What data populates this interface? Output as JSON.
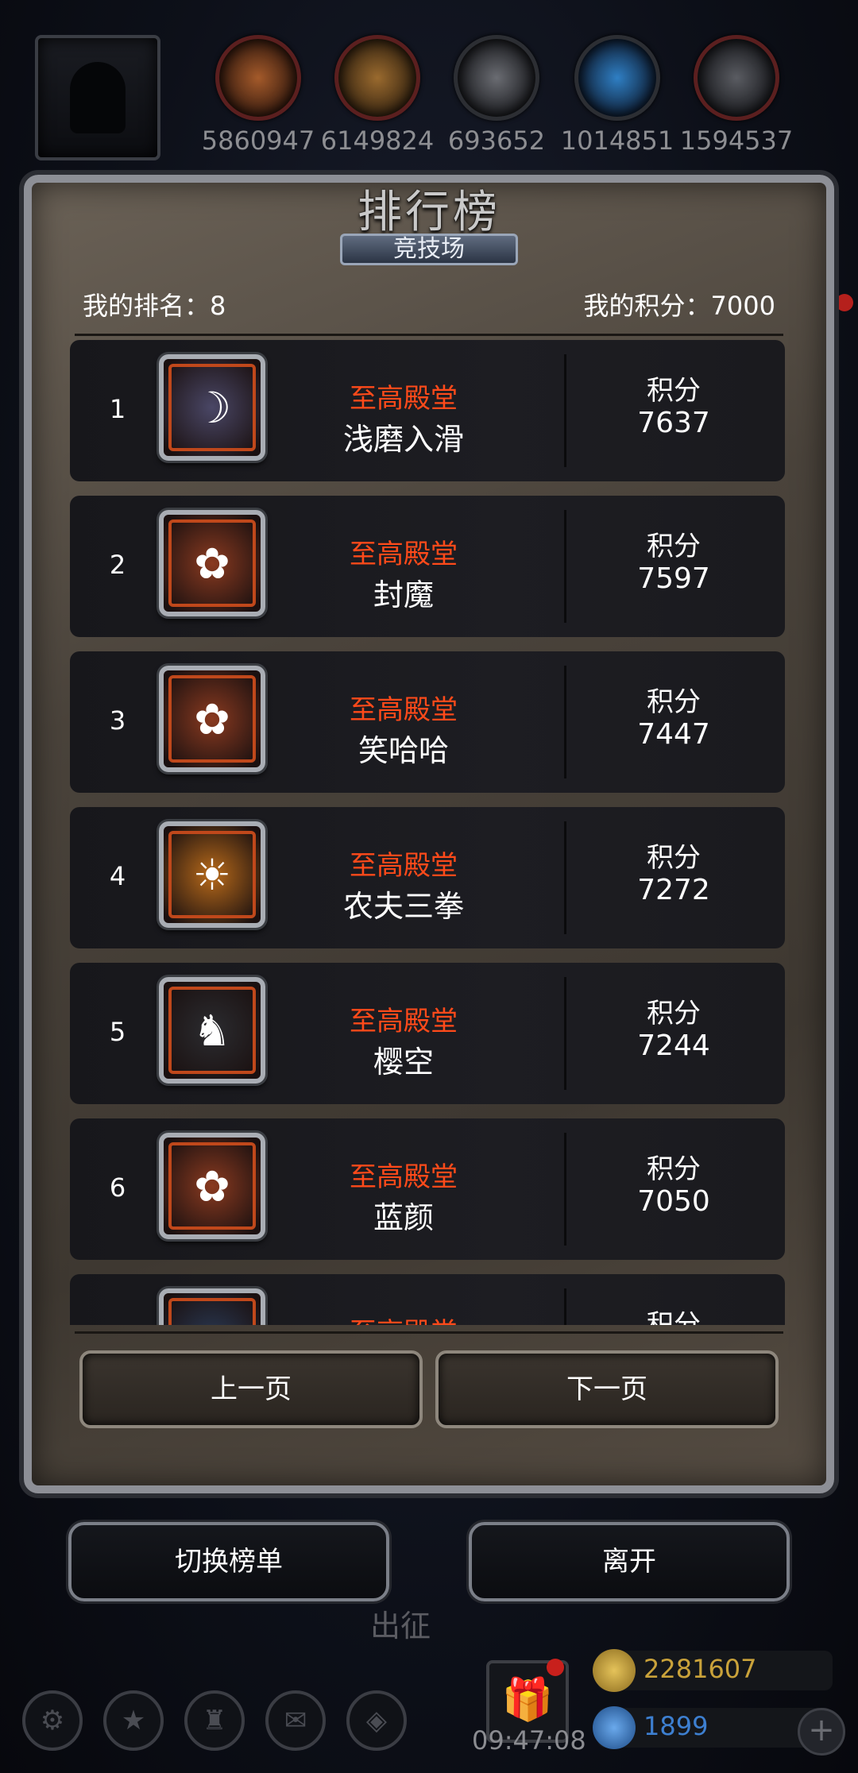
{
  "resources": [
    {
      "icon": "meat-icon",
      "value": "5860947",
      "color": "#a45a2a"
    },
    {
      "icon": "wood-icon",
      "value": "6149824",
      "color": "#9a6a2e"
    },
    {
      "icon": "iron-icon",
      "value": "693652",
      "color": "#6a6c72"
    },
    {
      "icon": "crystal-icon",
      "value": "1014851",
      "color": "#2f7fc4"
    },
    {
      "icon": "ore-icon",
      "value": "1594537",
      "color": "#5a5c62"
    }
  ],
  "panel": {
    "title": "排行榜",
    "tab": "竞技场",
    "my_rank": "我的排名：8",
    "my_score": "我的积分：7000"
  },
  "rows": [
    {
      "rank": "1",
      "guild": "至高殿堂",
      "name": "浅磨入滑",
      "score_label": "积分",
      "score": "7637",
      "portrait": "dark-elf-portrait-icon",
      "bg": "#4a4766"
    },
    {
      "rank": "2",
      "guild": "至高殿堂",
      "name": "封魔",
      "score_label": "积分",
      "score": "7597",
      "portrait": "rabbit-portrait-icon",
      "bg": "#8a3a20"
    },
    {
      "rank": "3",
      "guild": "至高殿堂",
      "name": "笑哈哈",
      "score_label": "积分",
      "score": "7447",
      "portrait": "rabbit-portrait-icon",
      "bg": "#8a3a20"
    },
    {
      "rank": "4",
      "guild": "至高殿堂",
      "name": "农夫三拳",
      "score_label": "积分",
      "score": "7272",
      "portrait": "dwarf-portrait-icon",
      "bg": "#b86a1a"
    },
    {
      "rank": "5",
      "guild": "至高殿堂",
      "name": "樱空",
      "score_label": "积分",
      "score": "7244",
      "portrait": "knight-helmet-portrait-icon",
      "bg": "#2b2c30"
    },
    {
      "rank": "6",
      "guild": "至高殿堂",
      "name": "蓝颜",
      "score_label": "积分",
      "score": "7050",
      "portrait": "rabbit-portrait-icon",
      "bg": "#8a3a20"
    },
    {
      "rank": "",
      "guild": "至高殿堂",
      "name": "",
      "score_label": "积分",
      "score": "",
      "portrait": "frost-portrait-icon",
      "bg": "#2a3a55"
    }
  ],
  "pagination": {
    "prev": "上一页",
    "next": "下一页"
  },
  "actions": {
    "switch": "切换榜单",
    "leave": "离开"
  },
  "background": {
    "deploy": "出征"
  },
  "bottom_bar": {
    "time": "09:47:08",
    "gold": "2281607",
    "gems": "1899",
    "gold_color": "#c9a23a",
    "gem_color": "#3d7fd0"
  }
}
